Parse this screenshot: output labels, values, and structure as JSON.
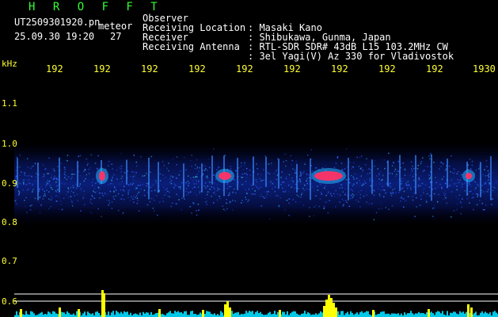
{
  "header": {
    "title": "H R O F F T",
    "filename": "UT2509301920.pn",
    "meteor_label": "meteor",
    "datetime": "25.09.30 19:20",
    "meteor_count": "27"
  },
  "info": [
    {
      "label": "Observer",
      "value": ": Masaki Kano"
    },
    {
      "label": "Receiving Location",
      "value": ": Shibukawa, Gunma, Japan"
    },
    {
      "label": "Receiver",
      "value": ": RTL-SDR SDR# 43dB L15 103.2MHz CW"
    },
    {
      "label": "Receiving Antenna",
      "value": ": 3el Yagi(V) Az 330 for Vladivostok"
    }
  ],
  "axes": {
    "y_unit": "kHz",
    "y_ticks": [
      "1.1",
      "1.0",
      "0.9",
      "0.8",
      "0.7",
      "0.6"
    ],
    "x_ticks": [
      "192",
      "192",
      "192",
      "192",
      "192",
      "192",
      "192",
      "192",
      "192",
      "1930"
    ]
  },
  "colors": {
    "background": "#000000",
    "header_title": "#33ff33",
    "header_text": "#ffffff",
    "tick_labels": "#ffff33",
    "grid": "#ffffff",
    "echo_yellow": "#ffff00",
    "noise_cyan": "#00c8e6",
    "spectrogram_noise": "#0a1e78",
    "spectrogram_hot": "#ff3264"
  }
}
